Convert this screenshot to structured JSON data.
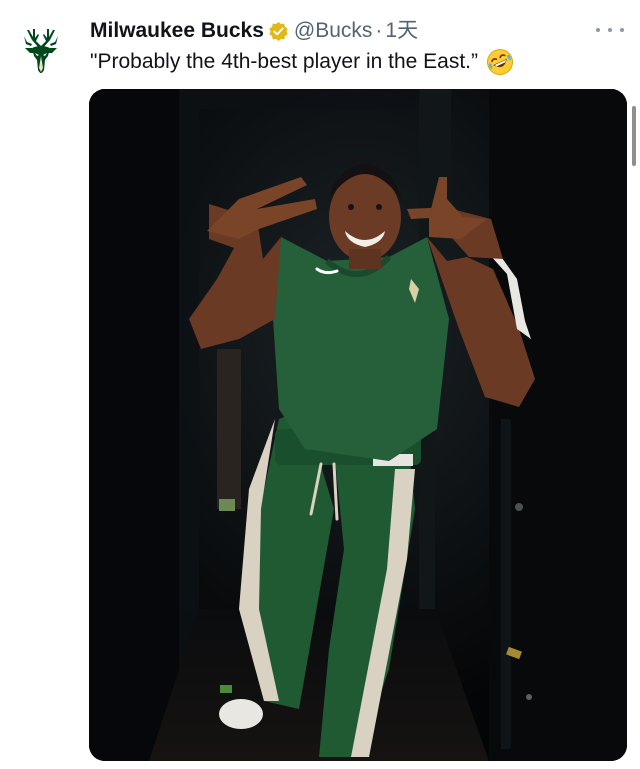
{
  "tweet": {
    "display_name": "Milwaukee Bucks",
    "verified_icon": "verified-gold-badge-icon",
    "handle": "@Bucks",
    "separator": "·",
    "time": "1天",
    "text": "\"Probably the 4th-best player in the East.”",
    "emoji": "rolling-on-floor-laughing-icon",
    "more_icon": "more-horizontal-icon",
    "avatar_icon": "bucks-deer-logo-icon"
  },
  "colors": {
    "bucks_green": "#00471b",
    "verified_gold": "#e2b719",
    "secondary_text": "#536471",
    "media_background": "#07090c"
  }
}
